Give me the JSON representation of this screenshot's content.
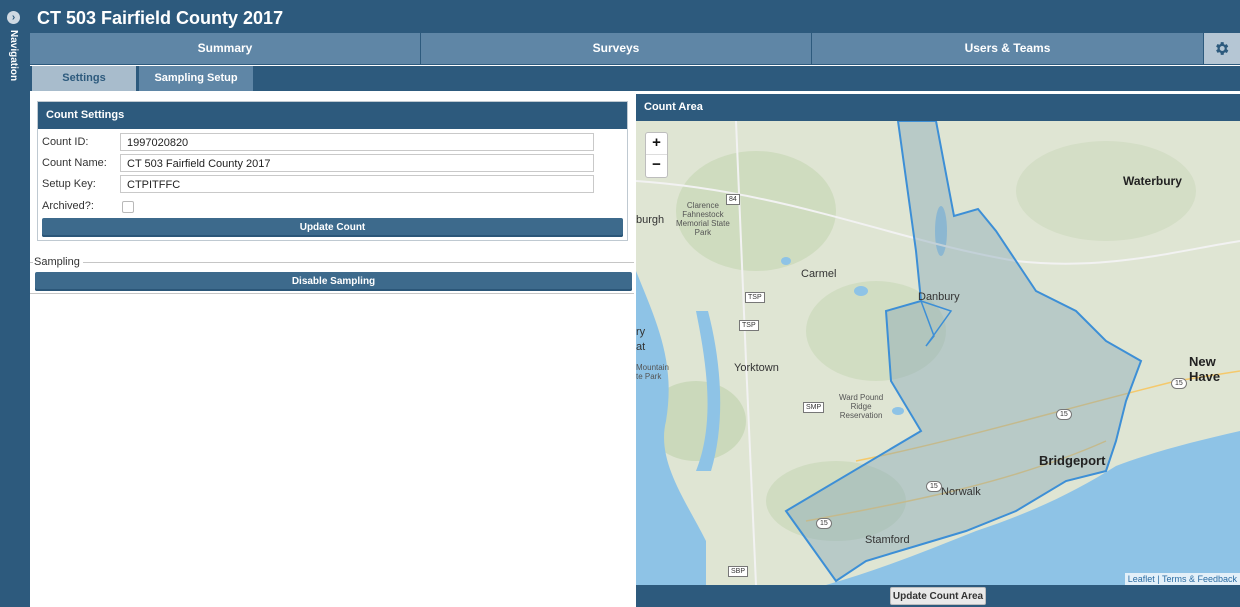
{
  "app": {
    "title": "CT 503 Fairfield County 2017",
    "nav_label": "Navigation",
    "nav_toggle_icon": "chevron-right-circle-icon"
  },
  "main_tabs": [
    {
      "label": "Summary"
    },
    {
      "label": "Surveys"
    },
    {
      "label": "Users & Teams"
    }
  ],
  "settings_icon": "gear-icon",
  "sub_tabs": [
    {
      "label": "Settings",
      "active": true
    },
    {
      "label": "Sampling Setup",
      "active": false
    }
  ],
  "count_settings": {
    "title": "Count Settings",
    "count_id_label": "Count ID:",
    "count_id_value": "1997020820",
    "count_name_label": "Count Name:",
    "count_name_value": "CT 503 Fairfield County 2017",
    "setup_key_label": "Setup Key:",
    "setup_key_value": "CTPITFFC",
    "archived_label": "Archived?:",
    "archived_checked": false,
    "update_button": "Update Count"
  },
  "sampling": {
    "legend": "Sampling",
    "button": "Disable Sampling"
  },
  "map": {
    "title": "Count Area",
    "zoom_in": "+",
    "zoom_out": "−",
    "attribution": "Leaflet | Terms & Feedback",
    "update_button": "Update Count Area",
    "places": {
      "waterbury": "Waterbury",
      "burgh": "burgh",
      "clarence": "Clarence\nFahnestock\nMemorial State\nPark",
      "carmel": "Carmel",
      "danbury": "Danbury",
      "new_haven": "New Have",
      "yorktown": "Yorktown",
      "mountain": "Mountain\nte Park",
      "ward_pound": "Ward Pound\nRidge\nReservation",
      "bridgeport": "Bridgeport",
      "norwalk": "Norwalk",
      "stamford": "Stamford",
      "ry": "ry",
      "at": "at"
    },
    "shields": [
      "84",
      "TSP",
      "TSP",
      "SMP",
      "15",
      "15",
      "15",
      "15",
      "SBP"
    ],
    "colors": {
      "land": "#dde3d0",
      "water": "#8ec3e6",
      "boundary": "#3d8fd6",
      "fill": "#8aa9b8"
    }
  },
  "colors": {
    "primary": "#2d5a7d",
    "tab": "#5f86a6",
    "subtab_active": "#a8bccc"
  }
}
